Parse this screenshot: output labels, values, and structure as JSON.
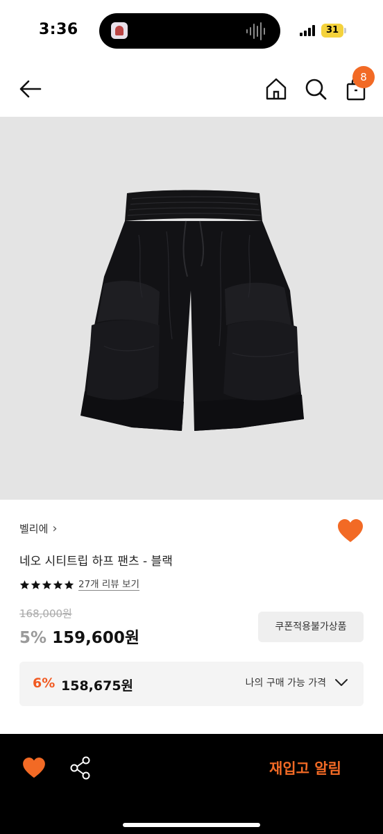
{
  "status_bar": {
    "time": "3:36",
    "battery": "31"
  },
  "header": {
    "cart_count": "8",
    "icons": [
      "back-arrow-icon",
      "home-icon",
      "search-icon",
      "shopping-bag-icon"
    ]
  },
  "product": {
    "brand": "벨리에",
    "brand_chevron": "›",
    "name": "네오 시티트립 하프 팬츠 - 블랙",
    "rating_stars": 5,
    "review_link": "27개 리뷰 보기",
    "original_price": "168,000원",
    "discount_rate": "5%",
    "sale_price": "159,600원",
    "coupon_note": "쿠폰적용불가상품"
  },
  "my_price": {
    "discount_rate": "6%",
    "price": "158,675원",
    "label": "나의 구매 가능 가격"
  },
  "bottom_bar": {
    "restock_label": "재입고 알림"
  },
  "colors": {
    "accent": "#f26a25",
    "bottom_bar_bg": "#000000",
    "image_bg": "#e4e4e4"
  }
}
